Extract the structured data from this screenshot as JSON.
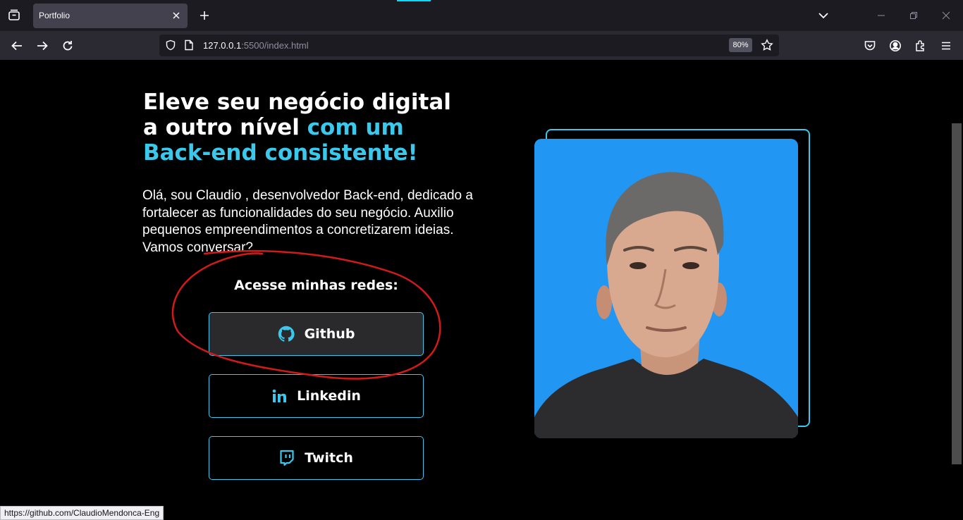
{
  "browser": {
    "tab_title": "Portfolio",
    "url_host": "127.0.0.1",
    "url_rest": ":5500/index.html",
    "zoom": "80%",
    "status_url": "https://github.com/ClaudioMendonca-Eng",
    "icons": [
      "tab-list-icon",
      "close-icon",
      "plus-icon",
      "chevron-down-icon",
      "minimize-icon",
      "restore-icon",
      "close-icon",
      "back-arrow-icon",
      "forward-arrow-icon",
      "reload-icon",
      "shield-icon",
      "page-icon",
      "star-icon",
      "pocket-icon",
      "account-icon",
      "extensions-icon",
      "hamburger-icon"
    ]
  },
  "hero": {
    "headline_line1": "Eleve seu negócio digital",
    "headline_line2_white": "a outro nível",
    "headline_line2_accent": "com um",
    "headline_line3": "Back-end consistente!",
    "intro": "Olá, sou Claudio , desenvolvedor Back-end, dedicado a fortalecer as funcionalidades do seu negócio. Auxilio pequenos empreendimentos a concretizarem ideias. Vamos conversar?",
    "social_heading": "Acesse minhas redes:",
    "buttons": {
      "github": "Github",
      "linkedin": "Linkedin",
      "twitch": "Twitch"
    }
  },
  "colors": {
    "accent": "#3ac8ec",
    "photo_background": "#2196f3",
    "annotation_red": "#d11a1a"
  }
}
